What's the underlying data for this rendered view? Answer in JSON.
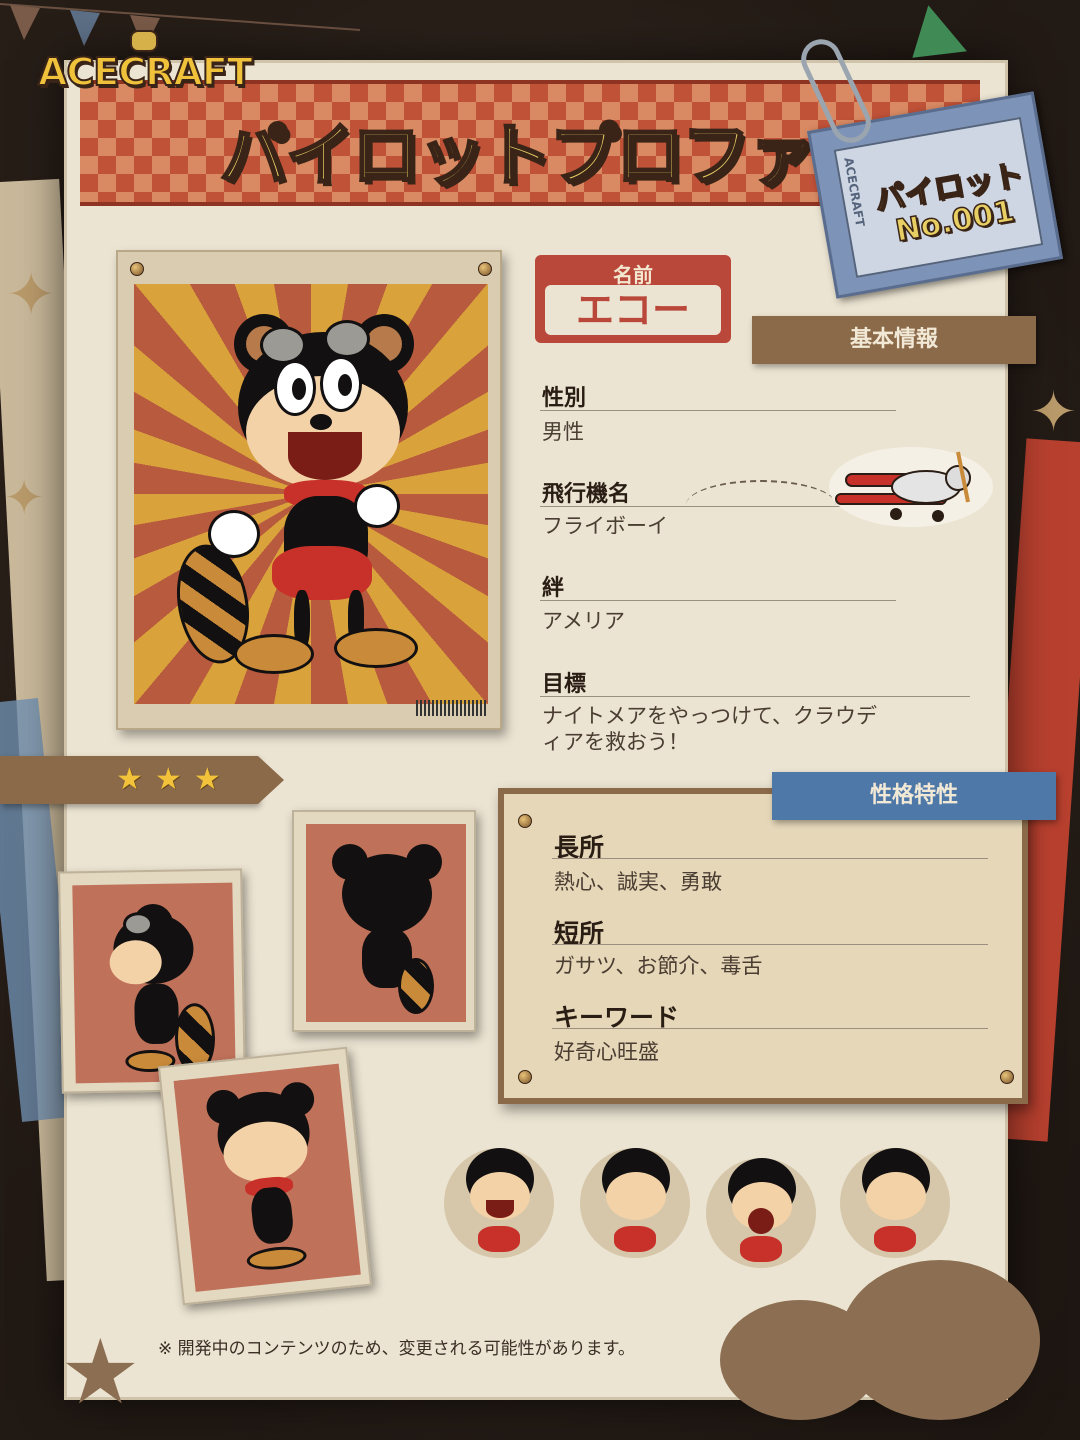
{
  "logo": {
    "text": "ACECRAFT"
  },
  "header": {
    "title": "パイロットプロファイル"
  },
  "pilot_tag": {
    "brand": "ACECRAFT",
    "line1": "パイロット",
    "line2": "No.001"
  },
  "name_plate": {
    "label": "名前",
    "value": "エコー"
  },
  "basic_info": {
    "ribbon": "基本情報",
    "fields": [
      {
        "label": "性別",
        "value": "男性"
      },
      {
        "label": "飛行機名",
        "value": "フライボーイ"
      },
      {
        "label": "絆",
        "value": "アメリア"
      },
      {
        "label": "目標",
        "value_line1": "ナイトメアをやっつけて、クラウデ",
        "value_line2": "ィアを救おう！"
      }
    ]
  },
  "rarity": {
    "stars": 3,
    "star_glyph": "★"
  },
  "traits": {
    "ribbon": "性格特性",
    "items": [
      {
        "label": "長所",
        "value": "熱心、誠実、勇敢"
      },
      {
        "label": "短所",
        "value": "ガサツ、お節介、毒舌"
      },
      {
        "label": "キーワード",
        "value": "好奇心旺盛"
      }
    ]
  },
  "footnote": "※ 開発中のコンテンツのため、変更される可能性があります。",
  "colors": {
    "accent_red": "#b9473a",
    "ribbon_brown": "#8b6a4a",
    "ribbon_blue": "#4e78a8",
    "title_yellow": "#e8cf63",
    "paper": "#ece4d2"
  },
  "icons": [
    "star-icon",
    "paperclip-icon",
    "pin-icon",
    "plane-icon",
    "barcode-icon"
  ]
}
